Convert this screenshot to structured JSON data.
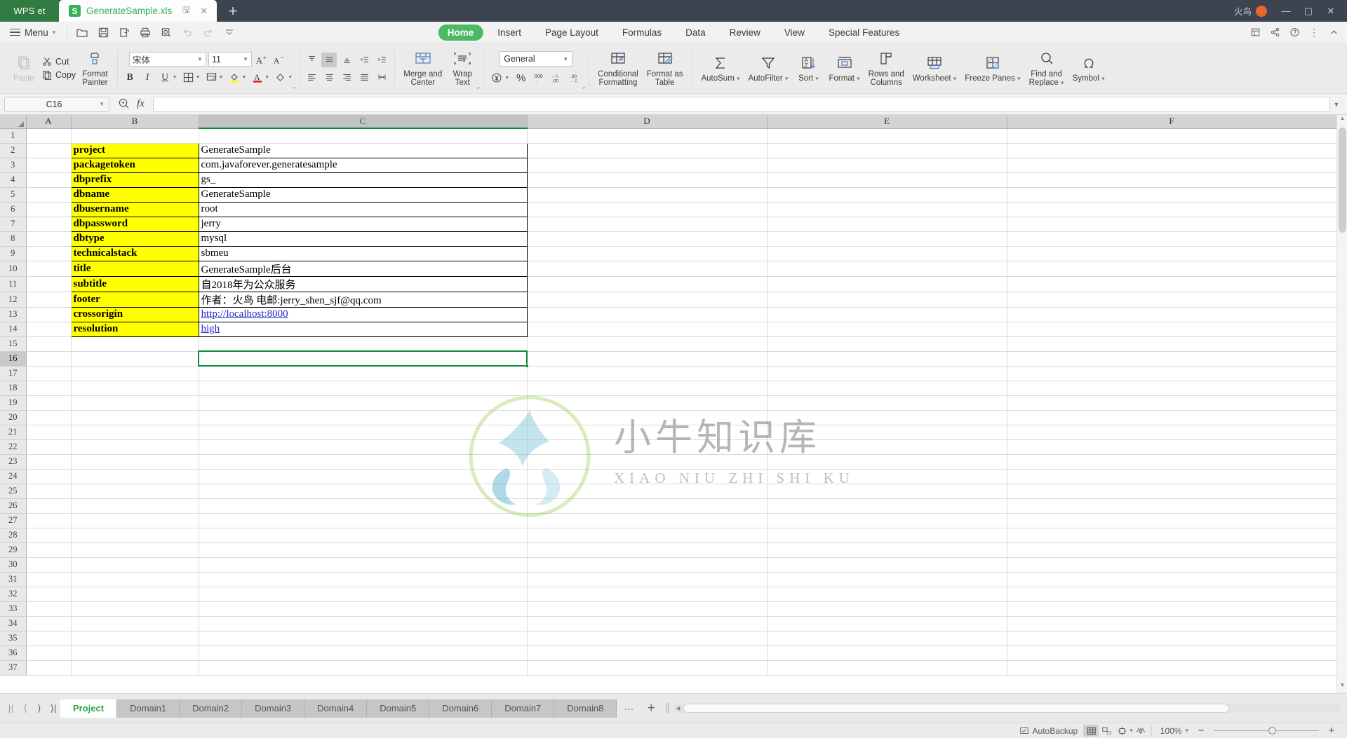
{
  "titlebar": {
    "app_badge": "WPS et",
    "doc_tab": {
      "label": "GenerateSample.xls",
      "icon": "S"
    },
    "new_tab_icon": "+",
    "user": "火鸟",
    "window_buttons": {
      "minimize": "—",
      "maximize": "▢",
      "close": "✕"
    }
  },
  "menurow": {
    "menu_label": "Menu",
    "quick_access": [
      "open-icon",
      "save-icon",
      "save-as-icon",
      "print-icon",
      "print-preview-icon",
      "undo-icon",
      "redo-icon",
      "customize-icon"
    ],
    "tabs": [
      {
        "label": "Home",
        "active": true
      },
      {
        "label": "Insert",
        "active": false
      },
      {
        "label": "Page Layout",
        "active": false
      },
      {
        "label": "Formulas",
        "active": false
      },
      {
        "label": "Data",
        "active": false
      },
      {
        "label": "Review",
        "active": false
      },
      {
        "label": "View",
        "active": false
      },
      {
        "label": "Special Features",
        "active": false
      }
    ],
    "right_tools": [
      "collaborate-icon",
      "share-icon",
      "help-icon",
      "more-icon",
      "collapse-ribbon-icon"
    ]
  },
  "ribbon": {
    "clipboard": {
      "paste": "Paste",
      "cut": "Cut",
      "copy": "Copy",
      "format_painter": "Format\nPainter"
    },
    "font": {
      "family": "宋体",
      "size": "11",
      "grow_label": "A+",
      "shrink_label": "A-",
      "bold": "B",
      "italic": "I",
      "underline": "U",
      "borders_icon": "borders-icon",
      "cell_style_icon": "cell-style-icon",
      "fill_color_icon": "fill-color-icon",
      "font_color_icon": "font-color-icon",
      "clear_format_icon": "clear-format-icon"
    },
    "alignment": {
      "merge_center": "Merge and\nCenter",
      "wrap_text": "Wrap\nText"
    },
    "number": {
      "format": "General",
      "currency_icon": "currency-icon",
      "percent_icon": "percent-icon",
      "comma_icon": "comma-icon",
      "decrease_decimal": "decrease-decimal-icon",
      "increase_decimal": "increase-decimal-icon"
    },
    "styles": {
      "conditional_formatting": "Conditional\nFormatting",
      "format_as_table": "Format as\nTable"
    },
    "editing": [
      {
        "label": "AutoSum",
        "icon": "sigma-icon"
      },
      {
        "label": "AutoFilter",
        "icon": "funnel-icon"
      },
      {
        "label": "Sort",
        "icon": "sort-az-icon"
      },
      {
        "label": "Format",
        "icon": "format-cells-icon"
      },
      {
        "label": "Rows and\nColumns",
        "icon": "rows-columns-icon"
      },
      {
        "label": "Worksheet",
        "icon": "worksheet-icon"
      },
      {
        "label": "Freeze Panes",
        "icon": "freeze-panes-icon"
      },
      {
        "label": "Find and\nReplace",
        "icon": "magnifier-icon"
      },
      {
        "label": "Symbol",
        "icon": "omega-icon"
      }
    ]
  },
  "formula_bar": {
    "name_box": "C16",
    "name_box_placeholder": "",
    "fx_label": "fx",
    "formula_value": "",
    "formula_placeholder": ""
  },
  "sheet": {
    "column_headers": [
      "A",
      "B",
      "C",
      "D",
      "E",
      "F"
    ],
    "selected_column": "C",
    "selected_cell": "C16",
    "row_count_visible": 37,
    "selected_row": 16,
    "rows": [
      {
        "n": 2,
        "key": "project",
        "value": "GenerateSample"
      },
      {
        "n": 3,
        "key": "packagetoken",
        "value": "com.javaforever.generatesample"
      },
      {
        "n": 4,
        "key": "dbprefix",
        "value": "gs_"
      },
      {
        "n": 5,
        "key": "dbname",
        "value": "GenerateSample"
      },
      {
        "n": 6,
        "key": "dbusername",
        "value": "root"
      },
      {
        "n": 7,
        "key": "dbpassword",
        "value": "jerry"
      },
      {
        "n": 8,
        "key": "dbtype",
        "value": "mysql"
      },
      {
        "n": 9,
        "key": "technicalstack",
        "value": "sbmeu"
      },
      {
        "n": 10,
        "key": "title",
        "value": "GenerateSample后台"
      },
      {
        "n": 11,
        "key": "subtitle",
        "value": "自2018年为公众服务"
      },
      {
        "n": 12,
        "key": "footer",
        "value": "作者：火鸟 电邮:jerry_shen_sjf@qq.com"
      },
      {
        "n": 13,
        "key": "crossorigin",
        "value": "http://localhost:8000",
        "link": true
      },
      {
        "n": 14,
        "key": "resolution",
        "value": "high",
        "link": true
      }
    ],
    "key_fill_color": "#ffff00",
    "selection_color": "#0a8a3c",
    "watermark": {
      "line1": "小牛知识库",
      "line2": "XIAO NIU ZHI SHI KU"
    }
  },
  "sheet_tabs": {
    "nav": [
      "first-sheet-icon",
      "prev-sheet-icon",
      "next-sheet-icon",
      "last-sheet-icon"
    ],
    "tabs": [
      {
        "label": "Project",
        "active": true
      },
      {
        "label": "Domain1",
        "active": false
      },
      {
        "label": "Domain2",
        "active": false
      },
      {
        "label": "Domain3",
        "active": false
      },
      {
        "label": "Domain4",
        "active": false
      },
      {
        "label": "Domain5",
        "active": false
      },
      {
        "label": "Domain6",
        "active": false
      },
      {
        "label": "Domain7",
        "active": false
      },
      {
        "label": "Domain8",
        "active": false
      }
    ],
    "more": "···",
    "add": "+"
  },
  "statusbar": {
    "autobackup": "AutoBackup",
    "view_normal_icon": "normal-view-icon",
    "view_pagebreak_icon": "page-break-view-icon",
    "view_layout_icon": "page-layout-icon",
    "eye_icon": "read-mode-icon",
    "zoom_level": "100%",
    "zoom_out": "−",
    "zoom_in": "+"
  }
}
